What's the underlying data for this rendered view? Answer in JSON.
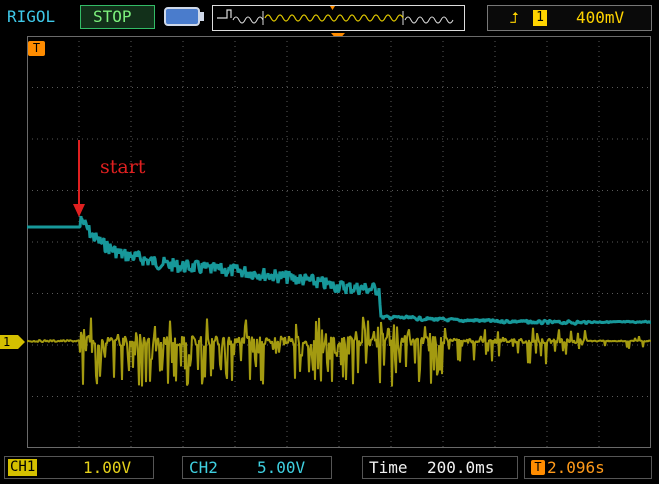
{
  "header": {
    "brand": "RIGOL",
    "status": "STOP",
    "trigger_channel": "1",
    "trigger_level": "400mV"
  },
  "footer": {
    "ch1_tag": "CH1",
    "ch1_scale": "1.00V",
    "ch2_tag": "CH2",
    "ch2_scale": "5.00V",
    "time_label": "Time",
    "time_scale": "200.0ms",
    "trigger_offset": "2.096s"
  },
  "markers": {
    "trigger_tag": "T",
    "ch1_ground": "1"
  },
  "annotation": {
    "text": "start"
  },
  "colors": {
    "ch1": "#a39a10",
    "ch2": "#17989a",
    "grid": "#5a5a5a",
    "annotation": "#e02020",
    "trigger": "#ff8c00"
  }
}
